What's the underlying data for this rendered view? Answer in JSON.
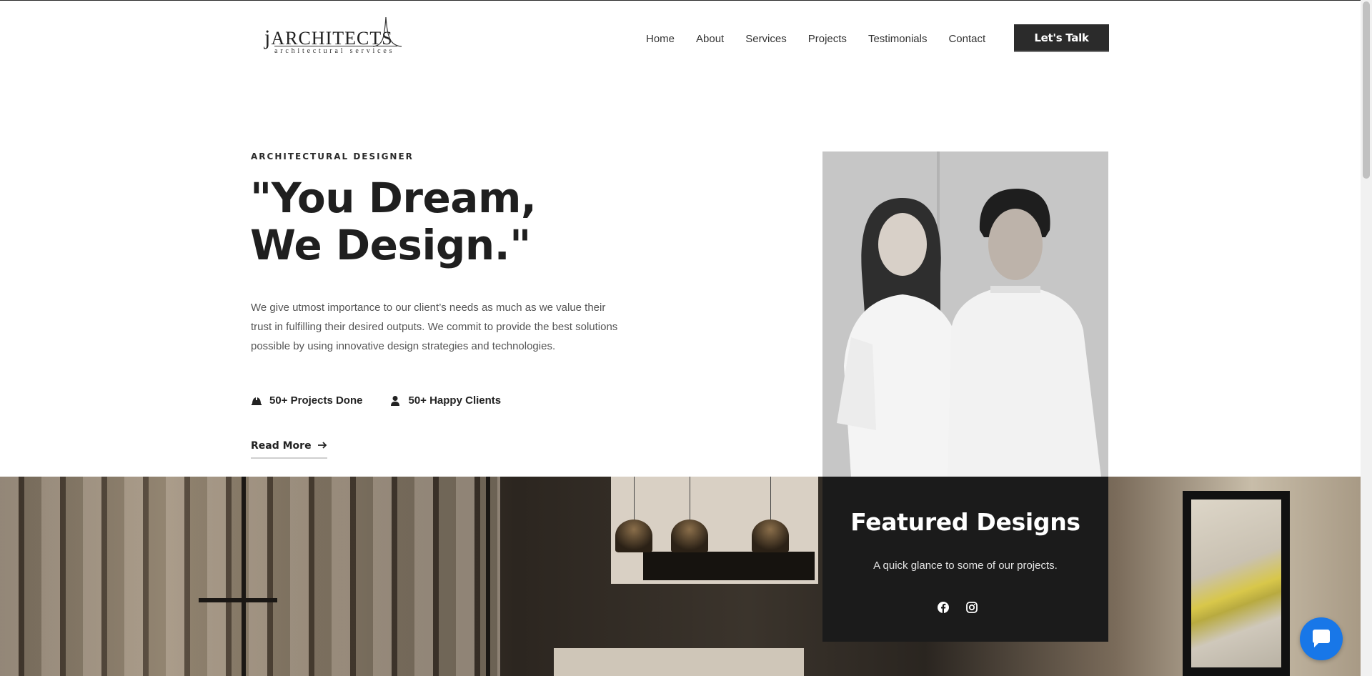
{
  "header": {
    "logo": {
      "main_first": "j",
      "main_rest": "ARCHITECTS",
      "tagline": "architectural services"
    },
    "nav": [
      "Home",
      "About",
      "Services",
      "Projects",
      "Testimonials",
      "Contact"
    ],
    "cta_label": "Let's Talk"
  },
  "hero": {
    "eyebrow": "ARCHITECTURAL DESIGNER",
    "headline": "\"You Dream, We Design.\"",
    "intro": " We give utmost importance to our client’s needs as much as we value their trust in fulfilling their desired outputs. We commit to provide the best solutions possible by using innovative design strategies and technologies.",
    "stats": [
      {
        "icon": "helmet-icon",
        "label": "50+ Projects Done"
      },
      {
        "icon": "user-icon",
        "label": "50+ Happy Clients"
      }
    ],
    "read_more": "Read More"
  },
  "featured": {
    "title": "Featured Designs",
    "subtitle": "A quick glance to some of our projects.",
    "social": [
      "facebook-icon",
      "instagram-icon"
    ]
  },
  "colors": {
    "dark": "#1b1b1b",
    "button": "#2b2b2b",
    "chat": "#1877e8"
  }
}
